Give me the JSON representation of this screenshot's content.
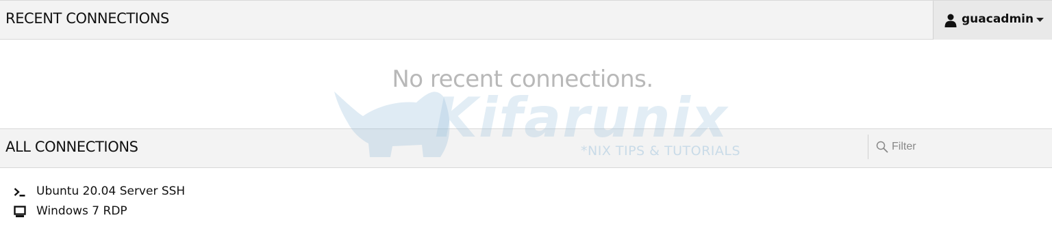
{
  "recent": {
    "title": "RECENT CONNECTIONS",
    "empty_message": "No recent connections."
  },
  "user_menu": {
    "username": "guacadmin",
    "icon": "user-icon"
  },
  "all": {
    "title": "ALL CONNECTIONS",
    "filter_placeholder": "Filter",
    "connections": [
      {
        "label": "Ubuntu 20.04 Server SSH",
        "icon": "terminal-icon"
      },
      {
        "label": "Windows 7 RDP",
        "icon": "monitor-icon"
      }
    ]
  },
  "watermark": {
    "brand": "Kifarunix",
    "tagline": "*NIX TIPS & TUTORIALS"
  },
  "colors": {
    "header_bg": "#f3f3f3",
    "user_menu_bg": "#e9e9e9",
    "empty_text": "#b8b8b8",
    "watermark": "#96bedc"
  }
}
